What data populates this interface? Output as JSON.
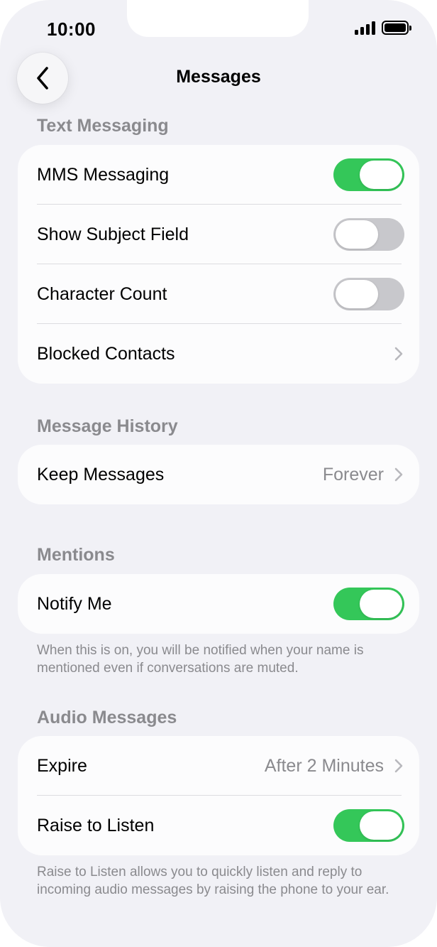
{
  "status_bar": {
    "time": "10:00"
  },
  "nav": {
    "title": "Messages",
    "back_icon": "chevron-left-icon"
  },
  "sections": {
    "text_messaging": {
      "header": "Text Messaging",
      "mms_messaging": {
        "label": "MMS Messaging",
        "on": true
      },
      "show_subject_field": {
        "label": "Show Subject Field",
        "on": false
      },
      "character_count": {
        "label": "Character Count",
        "on": false
      },
      "blocked_contacts": {
        "label": "Blocked Contacts"
      }
    },
    "message_history": {
      "header": "Message History",
      "keep_messages": {
        "label": "Keep Messages",
        "value": "Forever"
      }
    },
    "mentions": {
      "header": "Mentions",
      "notify_me": {
        "label": "Notify Me",
        "on": true
      },
      "footnote": "When this is on, you will be notified when your name is mentioned even if conversations are muted."
    },
    "audio_messages": {
      "header": "Audio Messages",
      "expire": {
        "label": "Expire",
        "value": "After 2 Minutes"
      },
      "raise_to_listen": {
        "label": "Raise to Listen",
        "on": true
      },
      "footnote": "Raise to Listen allows you to quickly listen and reply to incoming audio messages by raising the phone to your ear."
    }
  },
  "colors": {
    "background": "#f1f1f6",
    "group": "#fcfcfd",
    "toggle_on": "#34c759",
    "toggle_off": "#c8c8cc",
    "secondary_text": "#8a8a8e"
  }
}
